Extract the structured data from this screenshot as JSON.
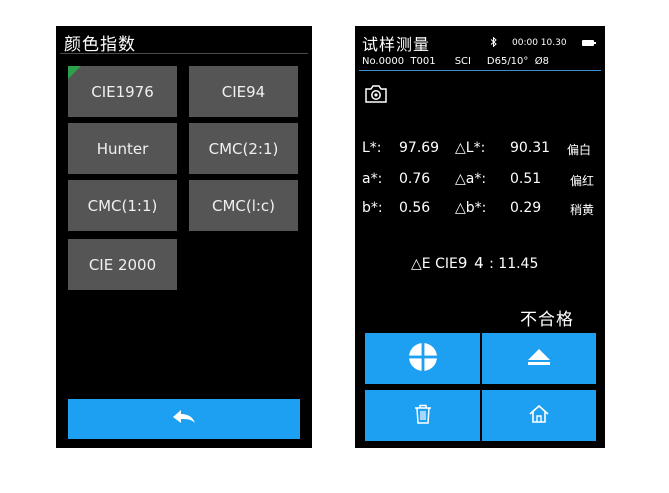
{
  "left": {
    "title": "颜色指数",
    "options": [
      "CIE1976",
      "CIE94",
      "Hunter",
      "CMC(2:1)",
      "CMC(1:1)",
      "CMC(l:c)",
      "CIE 2000"
    ],
    "selected": "CIE1976",
    "return_icon": "return-arrow-icon"
  },
  "right": {
    "title": "试样测量",
    "bluetooth_icon": "bluetooth-icon",
    "time": "00:00 10.30",
    "battery_icon": "battery-icon",
    "info": {
      "number": "No.0000",
      "target": "T001",
      "mode": "SCI",
      "illuminant": "D65/10°",
      "aperture": "Ø8"
    },
    "camera_icon": "camera-icon",
    "measurements": [
      {
        "label": "L*:",
        "value": "97.69",
        "delta_label": "△L*:",
        "delta_value": "90.31",
        "note": "偏白"
      },
      {
        "label": "a*:",
        "value": "0.76",
        "delta_label": "△a*:",
        "delta_value": "0.51",
        "note": "偏红"
      },
      {
        "label": "b*:",
        "value": "0.56",
        "delta_label": "△b*:",
        "delta_value": "0.29",
        "note": "稍黄"
      }
    ],
    "delta_e": {
      "prefix": "△E CIE",
      "suffix": "9 4",
      "value": ": 11.45"
    },
    "verdict": "不合格",
    "buttons": [
      "crosshair-icon",
      "eject-icon",
      "trash-icon",
      "home-icon"
    ],
    "accent": "#1d9ff2"
  }
}
